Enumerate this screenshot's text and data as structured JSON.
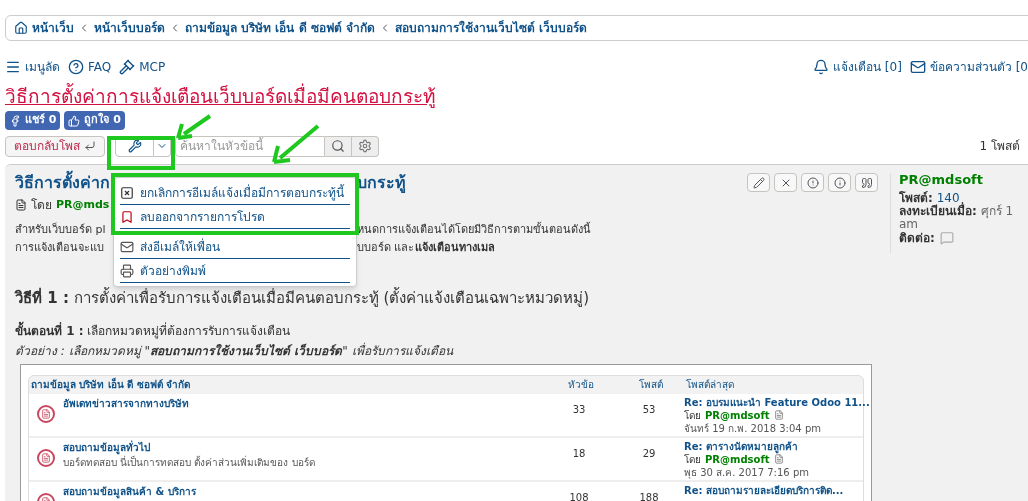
{
  "breadcrumbs": [
    {
      "label": "หน้าเว็บ",
      "kind": "home"
    },
    {
      "label": "หน้าเว็บบอร์ด",
      "kind": "link"
    },
    {
      "label": "ถามข้อมูล บริษัท เอ็น ดี ซอฟต์ จำกัด",
      "kind": "link"
    },
    {
      "label": "สอบถามการใช้งานเว็บไซต์ เว็บบอร์ด",
      "kind": "link"
    }
  ],
  "nav_left": [
    {
      "label": "เมนูลัด",
      "kind": "menu"
    },
    {
      "label": "FAQ",
      "kind": "help"
    },
    {
      "label": "MCP",
      "kind": "gavel"
    }
  ],
  "nav_right": [
    {
      "label": "แจ้งเตือน",
      "count": "[0]",
      "kind": "bell"
    },
    {
      "label": "ข้อความส่วนตัว",
      "count": "[0",
      "kind": "mail"
    }
  ],
  "topic_title": "วิธีการตั้งค่าการแจ้งเตือนเว็บบอร์ดเมื่อมีคนตอบกระทู้",
  "share_buttons": [
    {
      "label": "แชร์ 0",
      "kind": "facebook"
    },
    {
      "label": "ถูกใจ 0",
      "kind": "like"
    }
  ],
  "toolbar": {
    "reply": "ตอบกลับโพส",
    "search_placeholder": "ค้นหาในหัวข้อนี้",
    "post_count": "1 โพสต์"
  },
  "tools_menu": [
    {
      "label": "ยกเลิกการอีเมล์แจ้งเมื่อมีการตอบกระทู้นี้",
      "kind": "unsubscribe"
    },
    {
      "label": "ลบออกจากรายการโปรด",
      "kind": "bookmark"
    },
    {
      "label": "ส่งอีเมล์ให้เพื่อน",
      "kind": "mail"
    },
    {
      "label": "ตัวอย่างพิมพ์",
      "kind": "print"
    }
  ],
  "post": {
    "title_left": "วิธีการตั้งค่าก",
    "title_right": "บกระทู้",
    "by": "โดย",
    "author": "PR@mds",
    "para_lines": [
      {
        "left": "สำหรับเว็บบอร์ด pl",
        "right": "หนดการแจ้งเตือนได้โดยมีวิธีการตามขั้นตอนดังนี้"
      },
      {
        "left": "การแจ้งเตือนจะแบ",
        "right": "บบอร์ด และ**แจ้งเตือนทางเมล**"
      }
    ],
    "method": "**วิธีที่ 1 :** การตั้งค่าเพื่อรับการแจ้งเตือนเมื่อมีคนตอบกระทู้ (ตั้งค่าแจ้งเตือนเฉพาะหมวดหมู่)",
    "step": "**ขั้นตอนที่ 1 :** เลือกหมวดหมู่ที่ต้องการรับการแจ้งเตือน",
    "example": "ตัวอย่าง : เลือกหมวดหมู่ \"**สอบถามการใช้งานเว็บไซต์ เว็บบอร์ด**\" เพื่อรับการแจ้งเตือน"
  },
  "profile": {
    "name": "PR@mdsoft",
    "posts_label": "โพสต์:",
    "posts": "140",
    "joined_label": "ลงทะเบียนเมื่อ:",
    "joined": "ศุกร์ 1",
    "joined_2": "am",
    "contact_label": "ติดต่อ:"
  },
  "forum_table": {
    "columns": [
      "ถามข้อมูล บริษัท เอ็น ดี ซอฟต์ จำกัด",
      "หัวข้อ",
      "โพสต์",
      "โพสต์ล่าสุด"
    ],
    "rows": [
      {
        "name": "อัพเดทข่าวสารจากทางบริษัท",
        "description": "",
        "topics": "33",
        "posts": "53",
        "last_title": "Re: อบรมแนะนำ Feature Odoo 11...",
        "by": "โดย",
        "last_author": "PR@mdsoft",
        "last_date": "จันทร์ 19 ก.พ. 2018 3:04 pm"
      },
      {
        "name": "สอบถามข้อมูลทั่วไป",
        "description": "บอร์ดทดสอบ นี่เป็นการทดสอบ ตั้งค่าส่วนเพิ่มเติมของ บอร์ด",
        "topics": "18",
        "posts": "29",
        "last_title": "Re: ตารางนัดหมายลูกค้า",
        "by": "โดย",
        "last_author": "PR@mdsoft",
        "last_date": "พุธ 30 ส.ค. 2017 7:16 pm"
      },
      {
        "name": "สอบถามข้อมูลสินค้า & บริการ",
        "description": "",
        "topics": "108",
        "posts": "188",
        "last_title": "Re: สอบถามรายละเอียดบริการติด...",
        "by": "",
        "last_author": "",
        "last_date": ""
      }
    ]
  }
}
